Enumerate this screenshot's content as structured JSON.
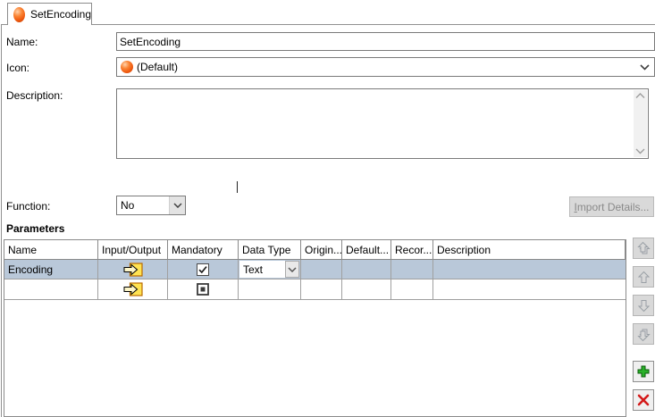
{
  "tab": {
    "label": "SetEncoding"
  },
  "form": {
    "name_label": "Name:",
    "name_value": "SetEncoding",
    "icon_label": "Icon:",
    "icon_value": "(Default)",
    "description_label": "Description:",
    "description_value": "",
    "function_label": "Function:",
    "function_value": "No",
    "import_button_label": "Import Details..."
  },
  "parameters": {
    "title": "Parameters",
    "columns": [
      "Name",
      "Input/Output",
      "Mandatory",
      "Data Type",
      "Origin...",
      "Default...",
      "Recor...",
      "Description"
    ],
    "rows": [
      {
        "name": "Encoding",
        "input_output": "input-arrow",
        "mandatory": "checked",
        "data_type": "Text",
        "origin": "",
        "default": "",
        "record": "",
        "description": "",
        "selected": true
      },
      {
        "name": "",
        "input_output": "input-arrow",
        "mandatory": "indeterminate",
        "data_type": "",
        "origin": "",
        "default": "",
        "record": "",
        "description": "",
        "selected": false
      }
    ]
  },
  "side_buttons": {
    "move_to_top": "up-double-arrow-icon",
    "move_up": "up-arrow-icon",
    "move_down": "down-arrow-icon",
    "move_to_bottom": "down-double-arrow-icon",
    "add": "plus-icon",
    "delete": "x-icon"
  },
  "colors": {
    "selected_row": "#b9c8d9",
    "accent_orange": "#ef5a10",
    "add_green": "#29b129",
    "delete_red": "#d41a1a"
  }
}
